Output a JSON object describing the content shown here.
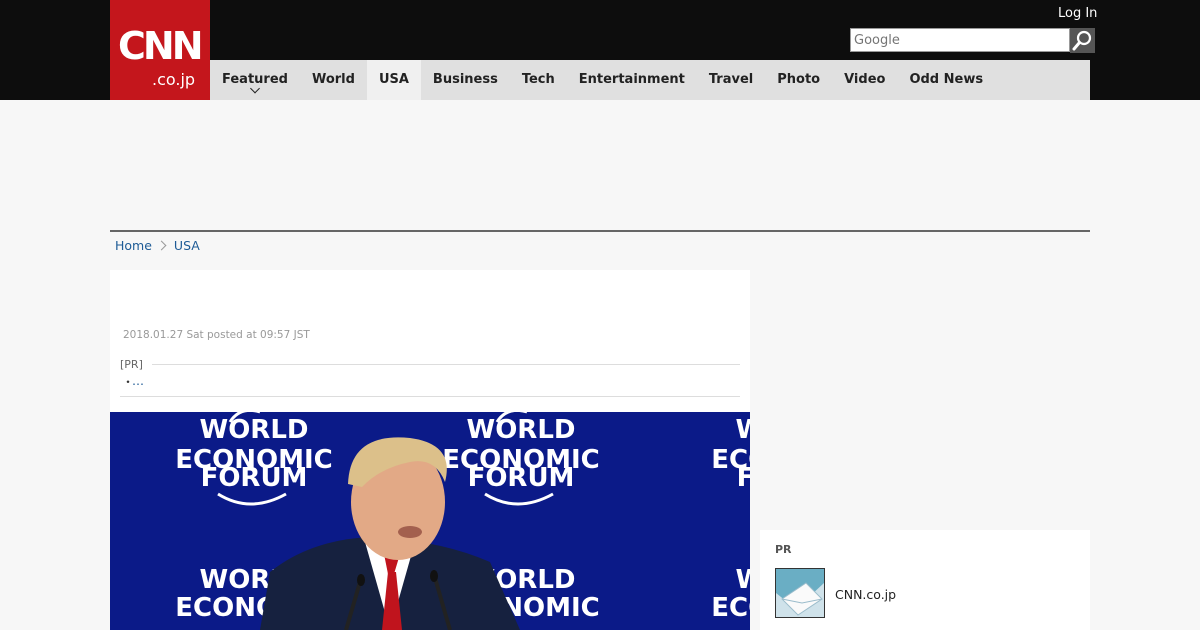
{
  "header": {
    "logo_main": "CNN",
    "logo_sub": ".co.jp",
    "login_label": "Log In",
    "search_placeholder": "Google",
    "nav": [
      {
        "label": "Featured"
      },
      {
        "label": "World"
      },
      {
        "label": "USA"
      },
      {
        "label": "Business"
      },
      {
        "label": "Tech"
      },
      {
        "label": "Entertainment"
      },
      {
        "label": "Travel"
      },
      {
        "label": "Photo"
      },
      {
        "label": "Video"
      },
      {
        "label": "Odd News"
      }
    ],
    "active_nav": "USA"
  },
  "breadcrumb": {
    "home": "Home",
    "current": "USA"
  },
  "article": {
    "posted": "2018.01.27 Sat posted at 09:57 JST",
    "pr_label": "[PR]",
    "pr_bullet": "・",
    "pr_link": "…",
    "photo_text": {
      "line1": "WORLD",
      "line2": "ECONOMIC",
      "line3": "FORUM"
    }
  },
  "sidebar": {
    "title": "PR",
    "item_label": "CNN.co.jp"
  },
  "colors": {
    "brand_red": "#c4161c",
    "header_bg": "#0d0d0d",
    "link_blue": "#1e5b96",
    "photo_bg": "#0b1a88"
  }
}
